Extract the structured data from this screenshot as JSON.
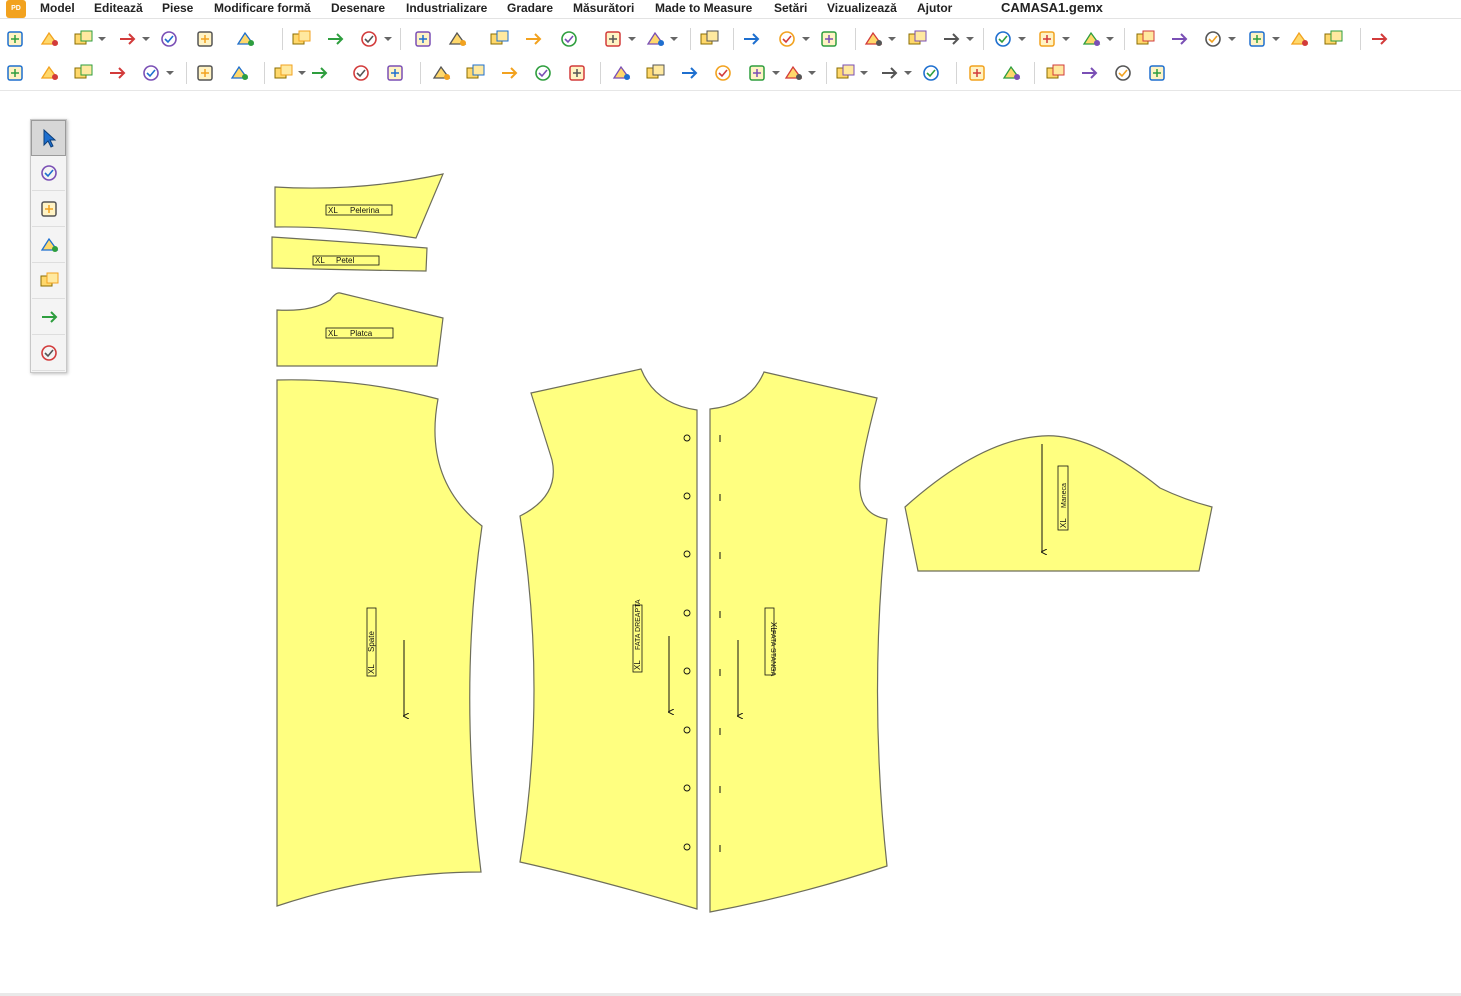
{
  "app": {
    "logo_text": "PD",
    "file_title": "CAMASA1.gemx"
  },
  "menu": [
    "Model",
    "Editează",
    "Piese",
    "Modificare formă",
    "Desenare",
    "Industrializare",
    "Gradare",
    "Măsurători",
    "Made to Measure",
    "Setări",
    "Vizualizează",
    "Ajutor"
  ],
  "toolbar1_icons": [
    "new-model-icon",
    "open-folder-icon",
    "open-old-icon",
    "save-icon",
    "model-tree-icon",
    "undo-icon",
    "redo-icon",
    "zoom-fit-icon",
    "zoom-window-icon",
    "zoom-in-icon",
    "text-label-icon",
    "annotation-icon",
    "mirror-horizontal-icon",
    "piece-stack-icon",
    "piece-layer-icon",
    "style-line-icon",
    "seam-arrow-icon",
    "delete-piece-icon",
    "grid-icon",
    "view-eye-icon",
    "point-snap-icon",
    "camera-icon",
    "house-3d-icon",
    "check-tool-icon",
    "notch-icon",
    "delete-notch-icon",
    "validate-icon",
    "table-icon",
    "table-edit-icon",
    "print-icon",
    "plotter-icon",
    "glasses-icon",
    "export-icon",
    "help-icon"
  ],
  "toolbar2_icons": [
    "piece-up-icon",
    "document-icon",
    "cut-icon",
    "basket-icon",
    "color-wheel-icon",
    "add-piece-icon",
    "add-piece-2-icon",
    "shape-1-icon",
    "shape-2-icon",
    "shape-3-icon",
    "shape-4-icon",
    "lock-piece-icon",
    "piece-frame-icon",
    "piece-delete-icon",
    "piece-tag-icon",
    "piece-check-icon",
    "align-vertical-icon",
    "flip-icon",
    "rotate-icon",
    "resize-icon",
    "align-left-icon",
    "mirror-icon",
    "grade-arrow-icon",
    "grade-vert-icon",
    "fast-forward-icon",
    "split-icon",
    "merge-icon",
    "seam-icon",
    "add-seam-icon",
    "offset-icon",
    "measure-box-icon"
  ],
  "tools": [
    "select-arrow-icon",
    "bezier-pen-icon",
    "pencil-icon",
    "pin-icon",
    "pattern-icon",
    "tape-measure-icon",
    "transform-icon"
  ],
  "colors": {
    "piece_fill": "#ffff80",
    "piece_stroke": "#6e6e5a",
    "accent": "#1e6fcf"
  },
  "pieces": [
    {
      "id": "pelerina",
      "size": "XL",
      "name": "Pelerina"
    },
    {
      "id": "pr",
      "size": "XL",
      "name": "Petel"
    },
    {
      "id": "platca",
      "size": "XL",
      "name": "Platca"
    },
    {
      "id": "spate",
      "size": "XL",
      "name": "Spate"
    },
    {
      "id": "fata-dreapta",
      "size": "XL",
      "name": "FATA DREAPTA"
    },
    {
      "id": "fata-stanga",
      "size": "XL",
      "name": "FATA STANGA"
    },
    {
      "id": "maneca",
      "size": "XL",
      "name": "Maneca"
    }
  ]
}
